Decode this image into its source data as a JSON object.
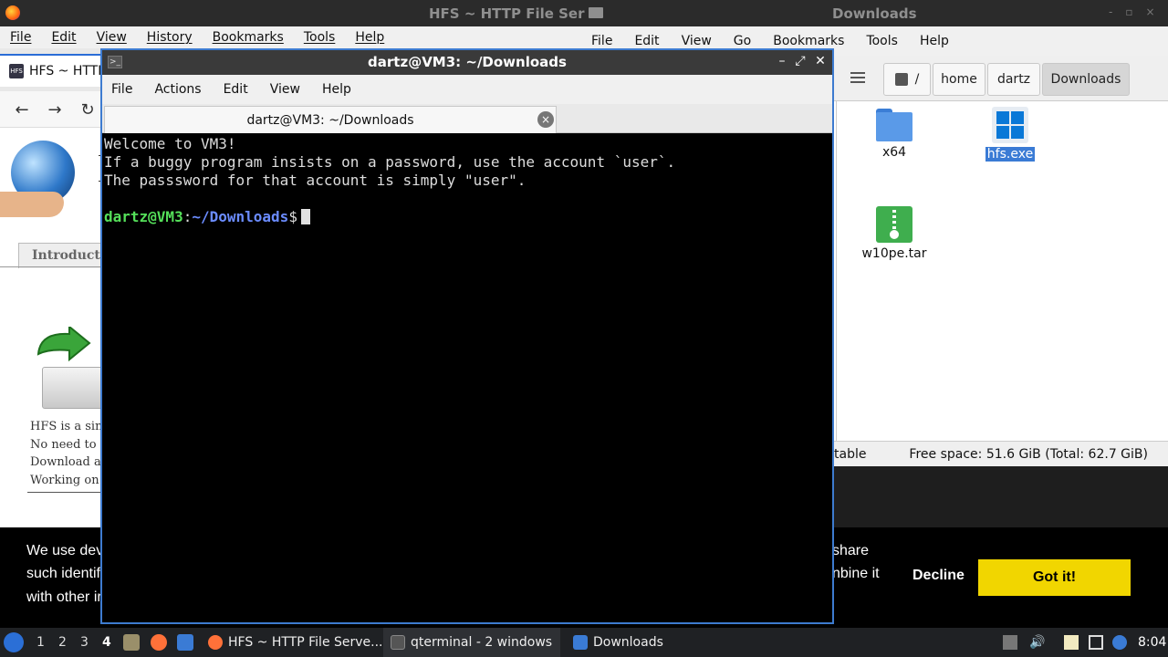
{
  "firefox": {
    "window_title": "HFS ~ HTTP File Ser",
    "menu": [
      "File",
      "Edit",
      "View",
      "History",
      "Bookmarks",
      "Tools",
      "Help"
    ],
    "tab_title": "HFS ~ HTTP",
    "tab_favicon_text": "HFS",
    "page": {
      "tab_intro": "Introducti",
      "lines": [
        "HFS is a sin",
        "No need to",
        "Download a",
        "Working on"
      ]
    },
    "cookie": {
      "text_left": [
        "We use dev",
        "such identif",
        "with other ir"
      ],
      "text_right": [
        "share",
        "nbine it"
      ],
      "decline": "Decline",
      "accept": "Got it!"
    }
  },
  "filemanager": {
    "window_title": "Downloads",
    "menu": [
      "File",
      "Edit",
      "View",
      "Go",
      "Bookmarks",
      "Tools",
      "Help"
    ],
    "breadcrumbs": [
      "/",
      "home",
      "dartz",
      "Downloads"
    ],
    "files": [
      {
        "name": "x64",
        "type": "folder",
        "selected": false
      },
      {
        "name": "hfs.exe",
        "type": "exe",
        "selected": true
      },
      {
        "name": "w10pe.tar",
        "type": "archive",
        "selected": false
      }
    ],
    "status_left": "table",
    "status_right": "Free space: 51.6 GiB (Total: 62.7 GiB)"
  },
  "terminal": {
    "window_title": "dartz@VM3: ~/Downloads",
    "menu": [
      "File",
      "Actions",
      "Edit",
      "View",
      "Help"
    ],
    "tab_title": "dartz@VM3: ~/Downloads",
    "lines": [
      "Welcome to VM3!",
      "If a buggy program insists on a password, use the account `user`.",
      "The passsword for that account is simply \"user\"."
    ],
    "prompt_user": "dartz@VM3",
    "prompt_sep": ":",
    "prompt_path": "~/Downloads",
    "prompt_symbol": "$"
  },
  "taskbar": {
    "workspaces": [
      "1",
      "2",
      "3",
      "4"
    ],
    "active_workspace": "4",
    "tasks": [
      "HFS ~ HTTP File Serve...",
      "qterminal - 2 windows",
      "Downloads"
    ],
    "clock": "8:04"
  },
  "colors": {
    "terminal_border": "#3d7bd0",
    "prompt_user": "#55e05a",
    "prompt_path": "#6b8cff",
    "cookie_accept": "#f1d600",
    "selection": "#3a7bd5"
  }
}
